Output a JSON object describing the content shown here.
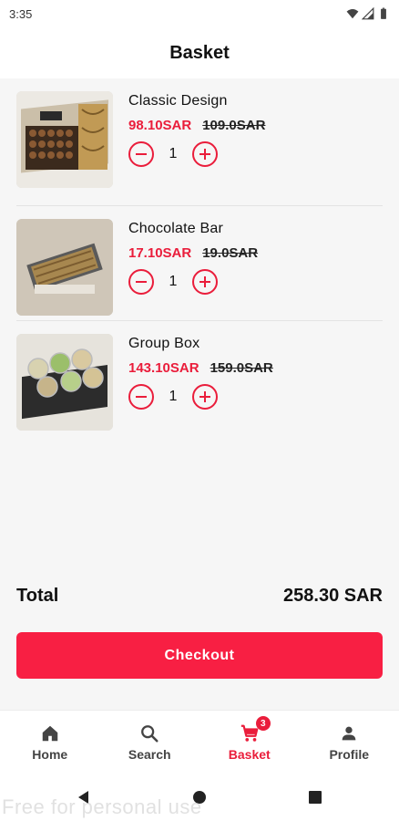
{
  "status_bar": {
    "time": "3:35"
  },
  "header": {
    "title": "Basket"
  },
  "items": [
    {
      "name": "Classic Design",
      "price": "98.10SAR",
      "old_price": "109.0SAR",
      "quantity": "1"
    },
    {
      "name": "Chocolate Bar",
      "price": "17.10SAR",
      "old_price": "19.0SAR",
      "quantity": "1"
    },
    {
      "name": "Group Box",
      "price": "143.10SAR",
      "old_price": "159.0SAR",
      "quantity": "1"
    }
  ],
  "summary": {
    "total_label": "Total",
    "total_value": "258.30 SAR",
    "checkout_label": "Checkout"
  },
  "bottom_nav": {
    "items": [
      {
        "label": "Home",
        "icon": "home-icon"
      },
      {
        "label": "Search",
        "icon": "search-icon"
      },
      {
        "label": "Basket",
        "icon": "cart-icon",
        "badge": "3",
        "active": true
      },
      {
        "label": "Profile",
        "icon": "person-icon"
      }
    ]
  },
  "watermark": "Free for personal use",
  "colors": {
    "accent": "#ea1d3b",
    "button": "#f81f43"
  }
}
